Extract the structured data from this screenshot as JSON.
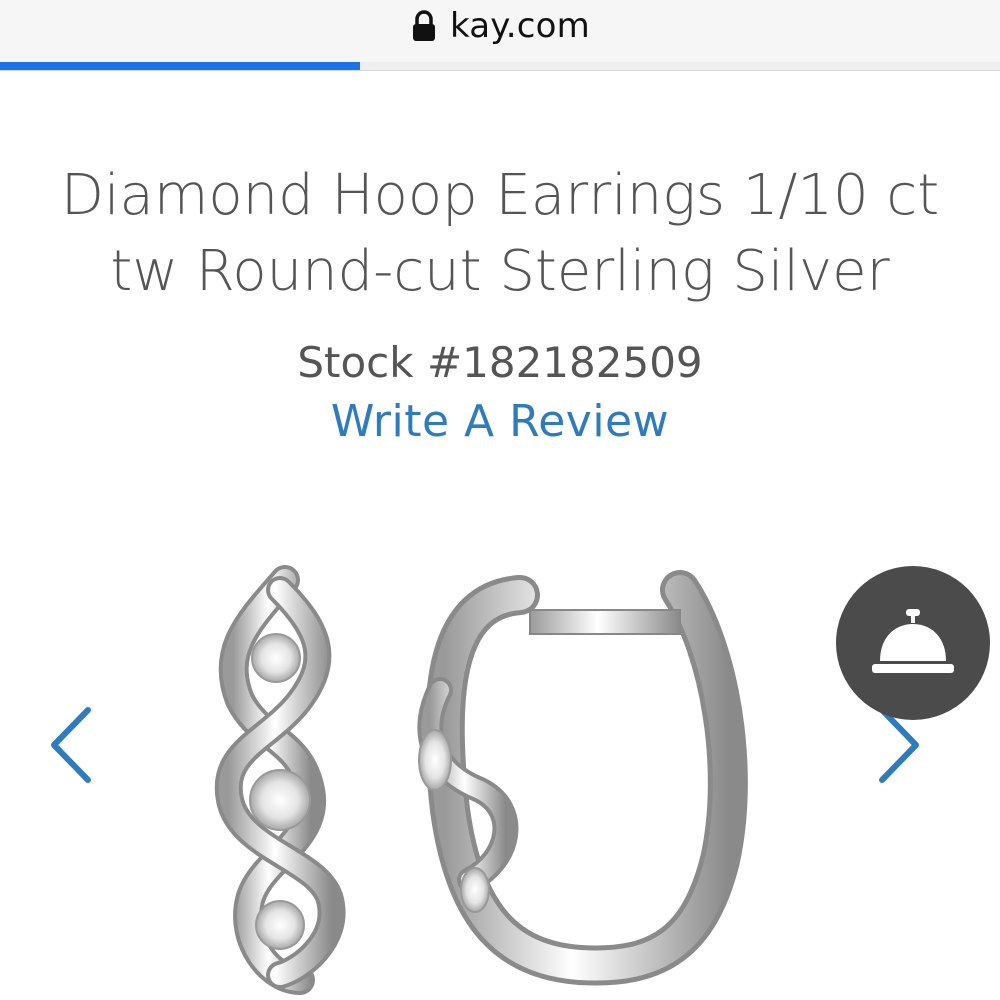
{
  "browser": {
    "url": "kay.com",
    "lock_icon": "lock-icon",
    "load_progress": 0.36,
    "progress_color": "#1a73e8"
  },
  "product": {
    "title_line1": "Diamond Hoop Earrings 1/10 ct",
    "title_line2": "tw Round-cut Sterling Silver",
    "stock": "Stock #182182509",
    "review_link": "Write A Review"
  },
  "gallery": {
    "prev_icon": "chevron-left-icon",
    "next_icon": "chevron-right-icon",
    "arrow_color": "#2f7bbf"
  },
  "chat": {
    "icon": "service-bell-icon",
    "background": "#4b4b4b"
  }
}
